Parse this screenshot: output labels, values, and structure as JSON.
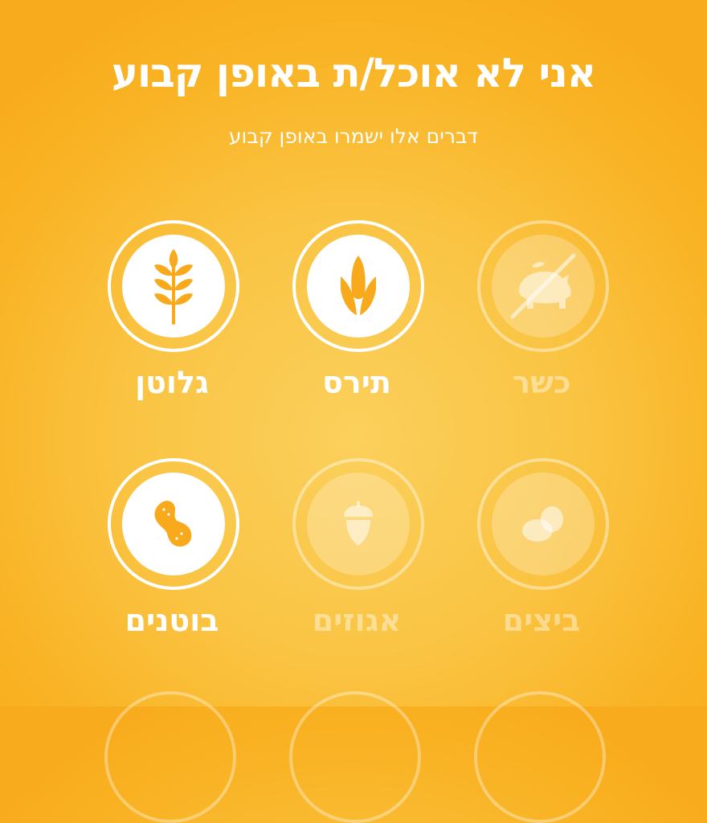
{
  "header": {
    "title": "אני לא אוכל/ת באופן קבוע",
    "subtitle": "דברים אלו ישמרו באופן קבוע"
  },
  "options": [
    {
      "label": "גלוטן",
      "icon": "wheat-icon",
      "selected": true
    },
    {
      "label": "תירס",
      "icon": "corn-icon",
      "selected": true
    },
    {
      "label": "כשר",
      "icon": "no-pork-icon",
      "selected": false
    },
    {
      "label": "בוטנים",
      "icon": "peanut-icon",
      "selected": true
    },
    {
      "label": "אגוזים",
      "icon": "acorn-icon",
      "selected": false
    },
    {
      "label": "ביצים",
      "icon": "eggs-icon",
      "selected": false
    }
  ],
  "colors": {
    "background": "#f9b324",
    "accent": "#f8a91c",
    "selected_disc": "#ffffff"
  }
}
